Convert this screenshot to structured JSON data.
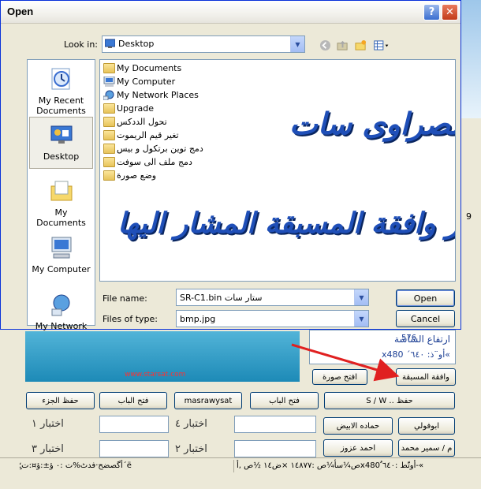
{
  "dialog": {
    "title": "Open",
    "help_label": "?",
    "close_label": "✕",
    "look_in_label": "Look in:",
    "look_in_value": "Desktop",
    "places": [
      {
        "label": "My Recent Documents",
        "icon": "recent-documents-icon"
      },
      {
        "label": "Desktop",
        "icon": "desktop-icon",
        "selected": true
      },
      {
        "label": "My Documents",
        "icon": "my-documents-icon"
      },
      {
        "label": "My Computer",
        "icon": "my-computer-icon"
      },
      {
        "label": "My Network",
        "icon": "my-network-icon"
      }
    ],
    "files": [
      {
        "name": "My Documents",
        "icon": "my-documents-icon"
      },
      {
        "name": "My Computer",
        "icon": "my-computer-icon"
      },
      {
        "name": "My Network Places",
        "icon": "network-places-icon"
      },
      {
        "name": "Upgrade",
        "icon": "folder-icon"
      },
      {
        "name": "تحول الددكس",
        "icon": "folder-icon"
      },
      {
        "name": "تغير قيم الريموت",
        "icon": "folder-icon"
      },
      {
        "name": "دمج توين برتكول و بيس",
        "icon": "folder-icon"
      },
      {
        "name": "دمج ملف الى سوفت",
        "icon": "folder-icon"
      },
      {
        "name": "وضع صورة",
        "icon": "folder-icon"
      }
    ],
    "file_name_label": "File name:",
    "file_name_value": "SR-C1.bin ستار سات",
    "file_type_label": "Files of type:",
    "file_type_value": "bmp.jpg",
    "open_label": "Open",
    "cancel_label": "Cancel"
  },
  "overlay": {
    "line1": "جابر احمد مصراوى سات",
    "line2": "لتغير الصوره اختار وافقة المسبقة المشار اليها"
  },
  "background": {
    "image_url": "www.starsat.com",
    "info_line1": "ارتفاع الشاشة",
    "info_line2": "x480 ´أو¨ذ: ٦٤٠«",
    "info_value": "576",
    "right_edge_text": "9",
    "approve_button": "وافقة المسبقة",
    "open_image_button": "افتح صورة",
    "row1_buttons": [
      "حفظ الجزء",
      "فتح الباب",
      "masrawysat",
      "فتح الباب",
      "S / W .. حفظ"
    ],
    "test_labels": [
      "اختبار ١",
      "اختبار ٤",
      "اختبار ٣",
      "اختبار ٢"
    ],
    "name_buttons": [
      "ابوفولي",
      "حماده الابيض",
      "احمد عزوز",
      "م / سمير محمد"
    ],
    "status_left": "أگصضح·فدٹ%ت :٠ ؤ±:ؤ¤:ت؛ٍ´ë",
    "status_right": "ص¼سأ¼ص :١٤٨٧٧ ×ض١٤ ½ص ,أx480 ٌأوتّط :٦٤٠-«"
  },
  "colors": {
    "overlay_text": "#1f4fb8",
    "arrow": "#e02020",
    "xp_border": "#0831d9"
  }
}
